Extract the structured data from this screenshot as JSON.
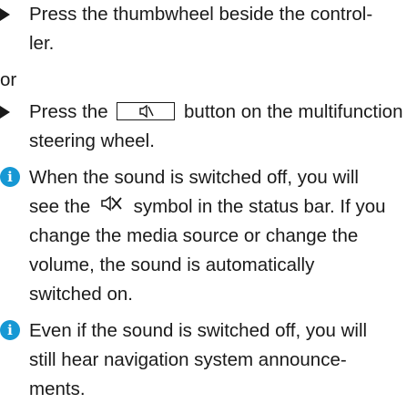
{
  "step1": {
    "line1": "Press the thumbwheel beside the control-",
    "line2": "ler."
  },
  "or_label": "or",
  "step2": {
    "before_button": "Press the",
    "after_button": "button on the multifunction",
    "line2": "steering wheel."
  },
  "info1": {
    "line1": "When the sound is switched off, you will",
    "line2_before": "see the",
    "line2_after": "symbol in the status bar. If you",
    "line3": "change the media source or change the",
    "line4": "volume, the sound is automatically",
    "line5": "switched on."
  },
  "info2": {
    "line1": "Even if the sound is switched off, you will",
    "line2": "still hear navigation system announce-",
    "line3": "ments."
  },
  "icons": {
    "step_marker": "triangle-bullet-icon",
    "info_marker": "info-icon",
    "button_symbol": "mute-button-icon",
    "status_symbol": "sound-off-icon"
  },
  "colors": {
    "info_icon": "#1698d4",
    "text": "#1a1a1a"
  },
  "info_glyph": "i"
}
